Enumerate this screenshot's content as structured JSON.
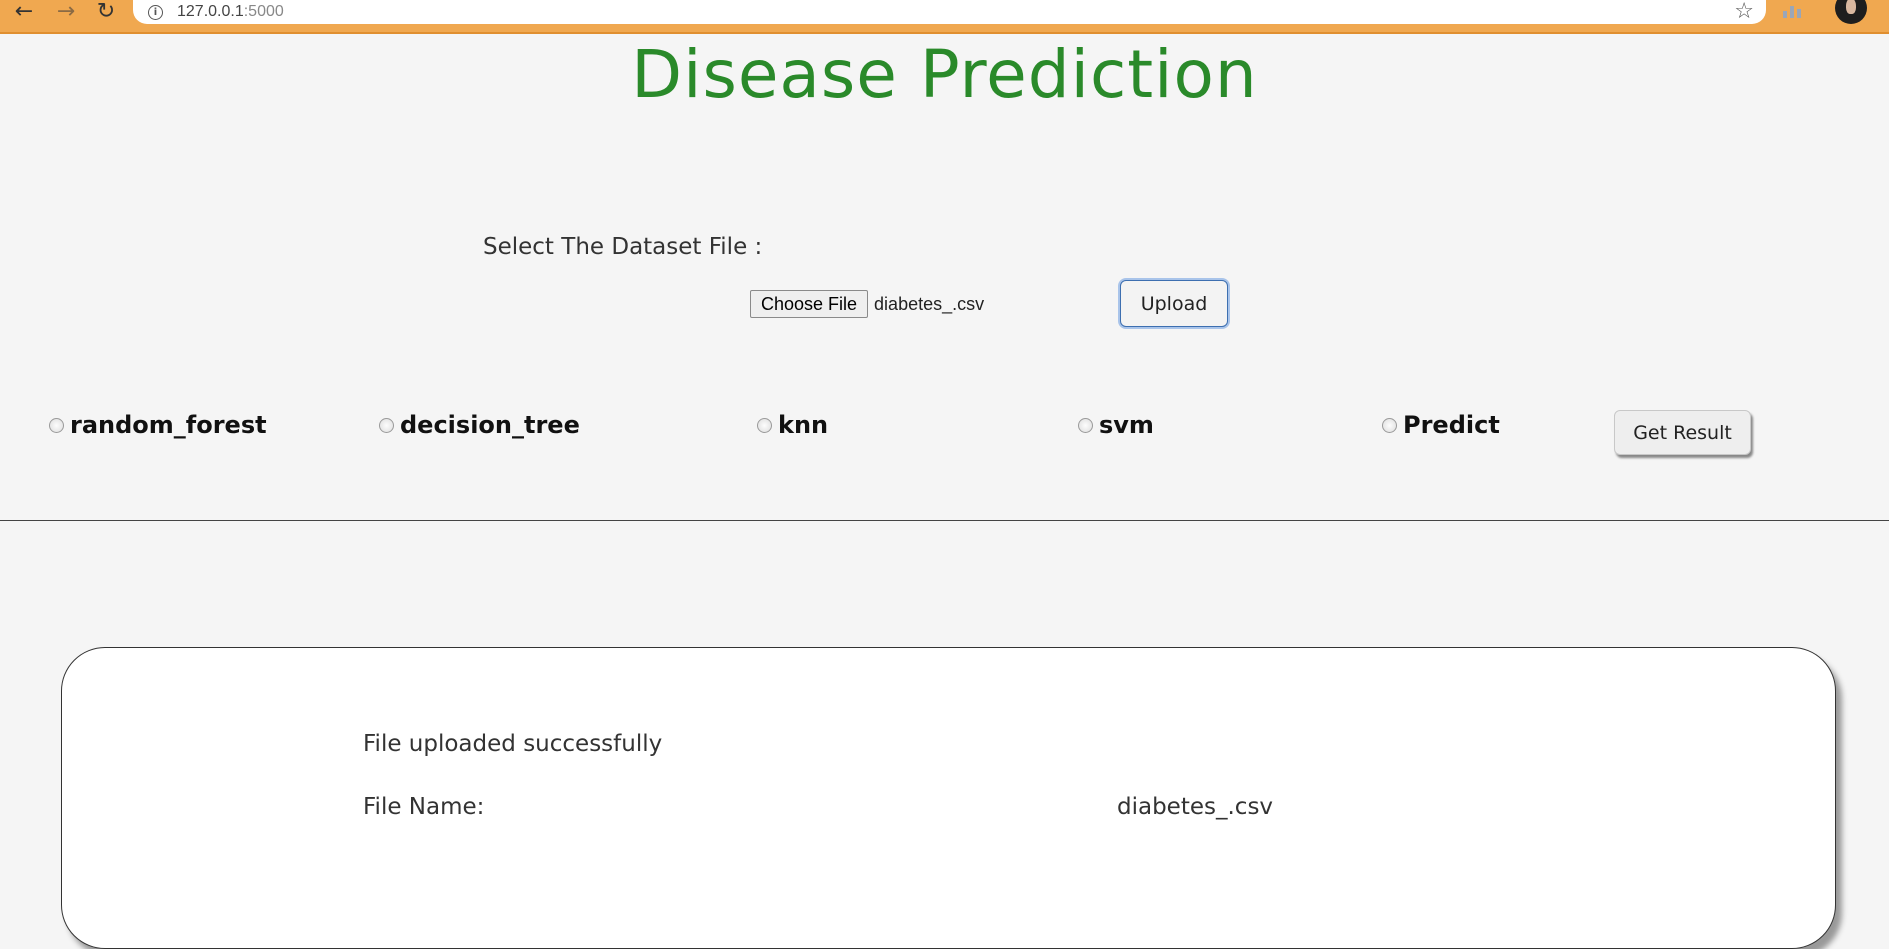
{
  "browser": {
    "url_host": "127.0.0.1",
    "url_port": ":5000",
    "icons": {
      "back": "back-arrow-icon",
      "forward": "forward-arrow-icon",
      "reload": "reload-icon",
      "info": "info-icon",
      "bookmark": "star-icon",
      "extension": "extension-icon",
      "profile": "avatar"
    }
  },
  "page": {
    "title": "Disease Prediction",
    "select_label": "Select The Dataset File :",
    "file_input": {
      "button_label": "Choose File",
      "selected_file": "diabetes_.csv"
    },
    "upload_label": "Upload",
    "algorithms": [
      {
        "label": "random_forest"
      },
      {
        "label": "decision_tree"
      },
      {
        "label": "knn"
      },
      {
        "label": "svm"
      },
      {
        "label": "Predict"
      }
    ],
    "get_result_label": "Get Result",
    "result": {
      "status_message": "File uploaded successfully",
      "file_name_label": "File Name:",
      "file_name_value": "diabetes_.csv"
    }
  },
  "colors": {
    "title": "#2a8a2a",
    "chrome": "#f0a850",
    "background": "#f5f5f5"
  }
}
